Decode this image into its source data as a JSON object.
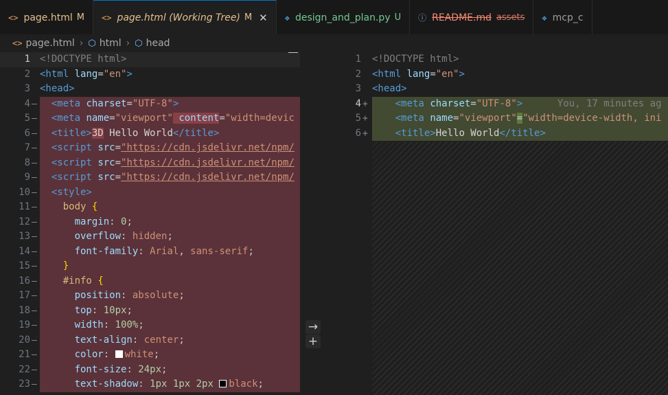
{
  "tabs": [
    {
      "icon": "<>",
      "label": "page.html",
      "badge": "M"
    },
    {
      "icon": "<>",
      "label": "page.html (Working Tree)",
      "badge": "M"
    },
    {
      "icon": "py",
      "label": "design_and_plan.py",
      "badge": "U"
    },
    {
      "icon": "i",
      "label": "README.md",
      "sub": "assets"
    },
    {
      "icon": "py",
      "label": "mcp_c"
    }
  ],
  "breadcrumb": {
    "file": "page.html",
    "html": "html",
    "head": "head"
  },
  "left": {
    "line_numbers": [
      "1",
      "2",
      "3",
      "4",
      "5",
      "6",
      "7",
      "8",
      "9",
      "10",
      "11",
      "12",
      "13",
      "14",
      "15",
      "16",
      "17",
      "18",
      "19",
      "20",
      "21",
      "22",
      "23"
    ],
    "code": {
      "l1": "<!DOCTYPE html>",
      "l2_tag": "<html",
      "l2_attr": "lang",
      "l2_val": "\"en\"",
      "l3": "<head>",
      "l4_attr": "charset",
      "l4_val": "\"UTF-8\"",
      "l5_attr1": "name",
      "l5_val1": "\"viewport\"",
      "l5_attr2": "content",
      "l5_val2": "\"width=devic",
      "l6_before": "3D",
      "l6_text": " Hello World",
      "script_src": "\"https://cdn.jsdelivr.net/npm/",
      "l11_sel": "body",
      "l12_prop": "margin",
      "l12_val": "0",
      "l13_prop": "overflow",
      "l13_val": "hidden",
      "l14_prop": "font-family",
      "l14_val1": "Arial",
      "l14_val2": "sans-serif",
      "l16_sel": "#info",
      "l17_prop": "position",
      "l17_val": "absolute",
      "l18_prop": "top",
      "l18_val": "10px",
      "l19_prop": "width",
      "l19_val": "100%",
      "l20_prop": "text-align",
      "l20_val": "center",
      "l21_prop": "color",
      "l21_val": "white",
      "l22_prop": "font-size",
      "l22_val": "24px",
      "l23_prop": "text-shadow",
      "l23_val1": "1px",
      "l23_val2": "1px",
      "l23_val3": "2px",
      "l23_val4": "black"
    }
  },
  "right": {
    "line_numbers": [
      "1",
      "2",
      "3",
      "4",
      "5",
      "6"
    ],
    "code": {
      "l1": "<!DOCTYPE html>",
      "l2_tag": "<html",
      "l2_attr": "lang",
      "l2_val": "\"en\"",
      "l3": "<head>",
      "l4_attr": "charset",
      "l4_val": "\"UTF-8\"",
      "l5_attr": "name",
      "l5_val1": "\"viewport\"",
      "l5_val2": "\"width=device-width, ini",
      "l6_text": "Hello World"
    },
    "blame": "You, 17 minutes ag"
  },
  "colors": {
    "removed_bg": "#5b3239",
    "added_bg": "#424a32",
    "active_tab_border": "#0078d4"
  }
}
